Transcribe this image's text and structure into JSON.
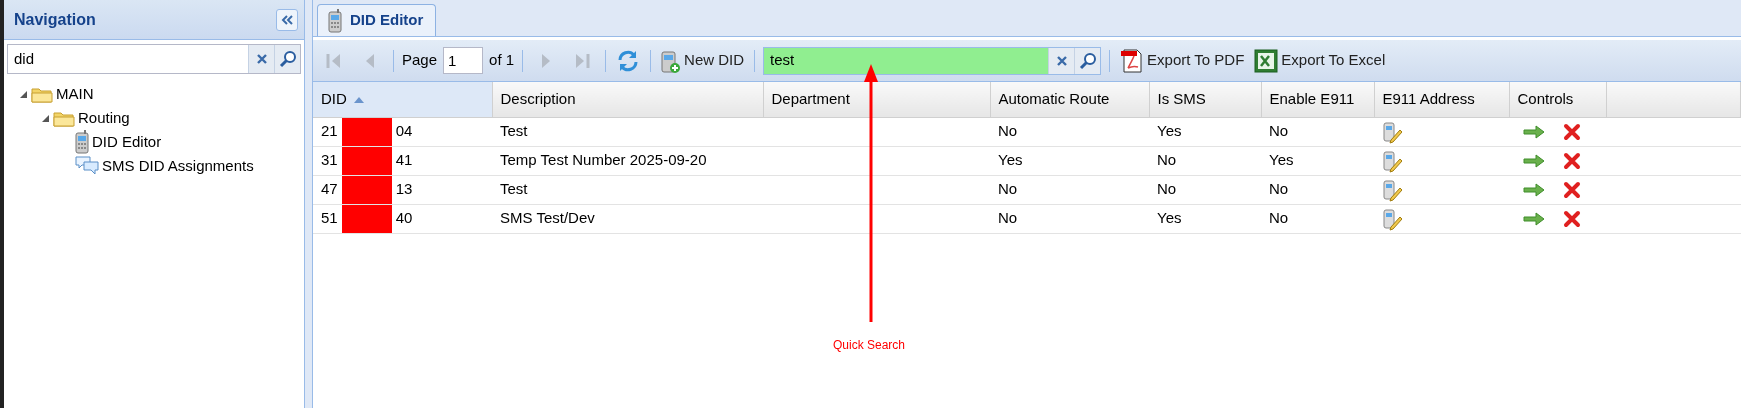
{
  "navigation": {
    "title": "Navigation",
    "search": {
      "value": "did"
    },
    "tree": [
      {
        "label": "MAIN",
        "kind": "folder",
        "expanded": true,
        "children": [
          {
            "label": "Routing",
            "kind": "folder",
            "expanded": true,
            "children": [
              {
                "label": "DID Editor",
                "kind": "phone"
              },
              {
                "label": "SMS DID Assignments",
                "kind": "chat"
              }
            ]
          }
        ]
      }
    ]
  },
  "tabs": [
    {
      "label": "DID Editor",
      "selected": true
    }
  ],
  "toolbar": {
    "pager": [
      {
        "kind": "first",
        "disabled": true
      },
      {
        "kind": "prev",
        "disabled": true
      }
    ],
    "page_label": "Page",
    "page": "1",
    "of_label": "of 1",
    "pager_end": [
      {
        "kind": "next",
        "disabled": true
      },
      {
        "kind": "last",
        "disabled": true
      }
    ],
    "new_button": "New DID",
    "quick_search": {
      "value": "test"
    },
    "export_pdf": "Export To PDF",
    "export_excel": "Export To Excel"
  },
  "table": {
    "columns": [
      {
        "label": "DID",
        "sorted": true
      },
      {
        "label": "Description",
        "sorted": false
      },
      {
        "label": "Department",
        "sorted": false
      },
      {
        "label": "Automatic Route",
        "sorted": false
      },
      {
        "label": "Is SMS",
        "sorted": false
      },
      {
        "label": "Enable E911",
        "sorted": false
      },
      {
        "label": "E911 Address",
        "sorted": false
      },
      {
        "label": "Controls",
        "sorted": false
      }
    ],
    "rows": [
      {
        "did_start": "21",
        "did_end": "04",
        "redacted": true,
        "description": "Test",
        "automatic_route": "No",
        "is_sms": "Yes",
        "enable_e911": "No"
      },
      {
        "did_start": "31",
        "did_end": "41",
        "redacted": true,
        "description": "Temp Test Number 2025-09-20",
        "automatic_route": "Yes",
        "is_sms": "No",
        "enable_e911": "Yes"
      },
      {
        "did_start": "47",
        "did_end": "13",
        "redacted": true,
        "description": "Test",
        "automatic_route": "No",
        "is_sms": "No",
        "enable_e911": "No"
      },
      {
        "did_start": "51",
        "did_end": "40",
        "redacted": true,
        "description": "SMS Test/Dev",
        "automatic_route": "No",
        "is_sms": "Yes",
        "enable_e911": "No"
      }
    ]
  },
  "annotation": {
    "label": "Quick Search"
  }
}
